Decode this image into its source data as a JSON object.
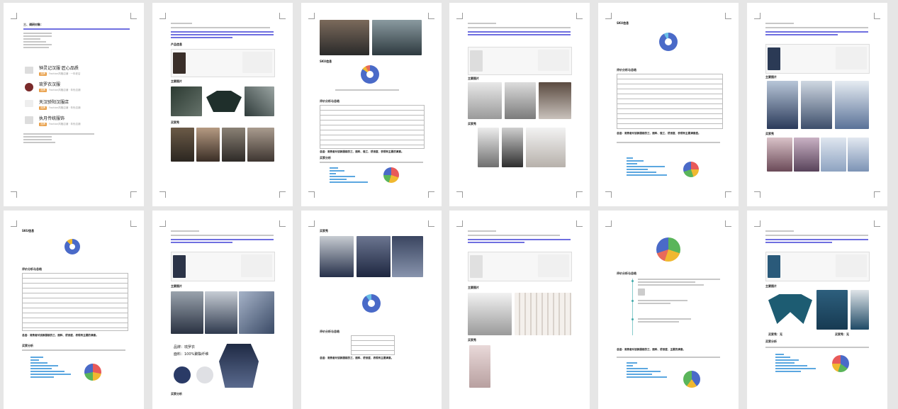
{
  "pages": {
    "p1": {
      "heading": "三、调研对象：",
      "stores": [
        {
          "name": "钟灵记汉服 匠心品质",
          "tag": "品牌",
          "sub": "Fashion风格店铺 · 一年老店"
        },
        {
          "name": "琉罗衣汉服",
          "tag": "品牌",
          "sub": "Fashion风格店铺 · 年份店铺"
        },
        {
          "name": "天汉骄阳汉服店",
          "tag": "品牌",
          "sub": "Fashion风格店铺 · 年份店铺"
        },
        {
          "name": "执月传统服饰",
          "tag": "品牌",
          "sub": "Fashion风格店铺 · 年份店铺"
        }
      ]
    },
    "p2": {
      "heading": "产品信息",
      "section1": "主要图片",
      "section2": "买家秀"
    },
    "p3": {
      "section1": "SKU信息",
      "section2": "评价分析与总结",
      "summary": "总结：消费者对该款服装的三、面料、做工、舒适度、表现有主要的满意。",
      "section3": "买家分析"
    },
    "p4": {
      "section1": "主要图片",
      "section2": "买家秀"
    },
    "p5": {
      "section1": "SKU信息",
      "section2": "评价分析与总结",
      "summary": "总结：消费者对该款服装的三、面料、做工、舒适度、表现有主要满意度。"
    },
    "p6": {
      "section1": "主要图片",
      "section2": "买家秀"
    },
    "p7": {
      "section1": "SKU信息",
      "section2": "评价分析与总结",
      "summary": "总结：消费者对该款服装的三、面料、舒适度、表现有主要的满意。",
      "section3": "买家分析"
    },
    "p8": {
      "section1": "主要图片",
      "caption1": "品牌：琉罗衣",
      "caption2": "面料：100%聚酯纤维",
      "section2": "买家分析"
    },
    "p9": {
      "section1": "买家秀",
      "section2": "评价分析与总结",
      "summary": "总结：消费者对该款服装的三、面料、舒适度、表现有主要满意。"
    },
    "p10": {
      "section1": "主要图片",
      "section2": "买家秀"
    },
    "p11": {
      "section1": "评价分析与总结",
      "summary": "总结：消费者对该款服装的三、面料、舒适度、主要的满意。"
    },
    "p12": {
      "section1": "主要图片",
      "caption1": "买家秀：无",
      "caption2": "买家秀：无",
      "section2": "买家分析"
    }
  }
}
